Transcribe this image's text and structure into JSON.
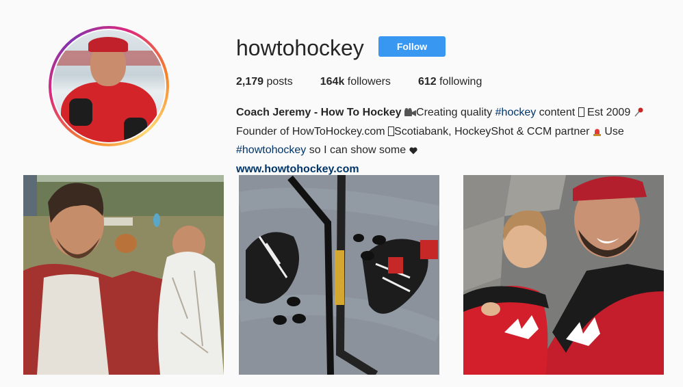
{
  "profile": {
    "username": "howtohockey",
    "follow_label": "Follow"
  },
  "stats": {
    "posts_count": "2,179",
    "posts_label": "posts",
    "followers_count": "164k",
    "followers_label": "followers",
    "following_count": "612",
    "following_label": "following"
  },
  "bio": {
    "name": "Coach Jeremy - How To Hockey",
    "text1": "Creating quality ",
    "hashtag1": "#hockey",
    "text2": " content ",
    "text3": " Est 2009 ",
    "text4": "Founder of HowToHockey.com ",
    "text5": "Scotiabank, HockeyShot & CCM partner ",
    "text6": " Use",
    "hashtag2": "#howtohockey",
    "text7": " so I can show some ",
    "website": "www.howtohockey.com"
  },
  "colors": {
    "follow_button": "#3897f0",
    "link": "#003569"
  },
  "posts": [
    {
      "alt": "man holding a tarp in a backyard"
    },
    {
      "alt": "hockey skates, sticks and pucks on ice"
    },
    {
      "alt": "father and son in Team Canada jerseys"
    }
  ]
}
